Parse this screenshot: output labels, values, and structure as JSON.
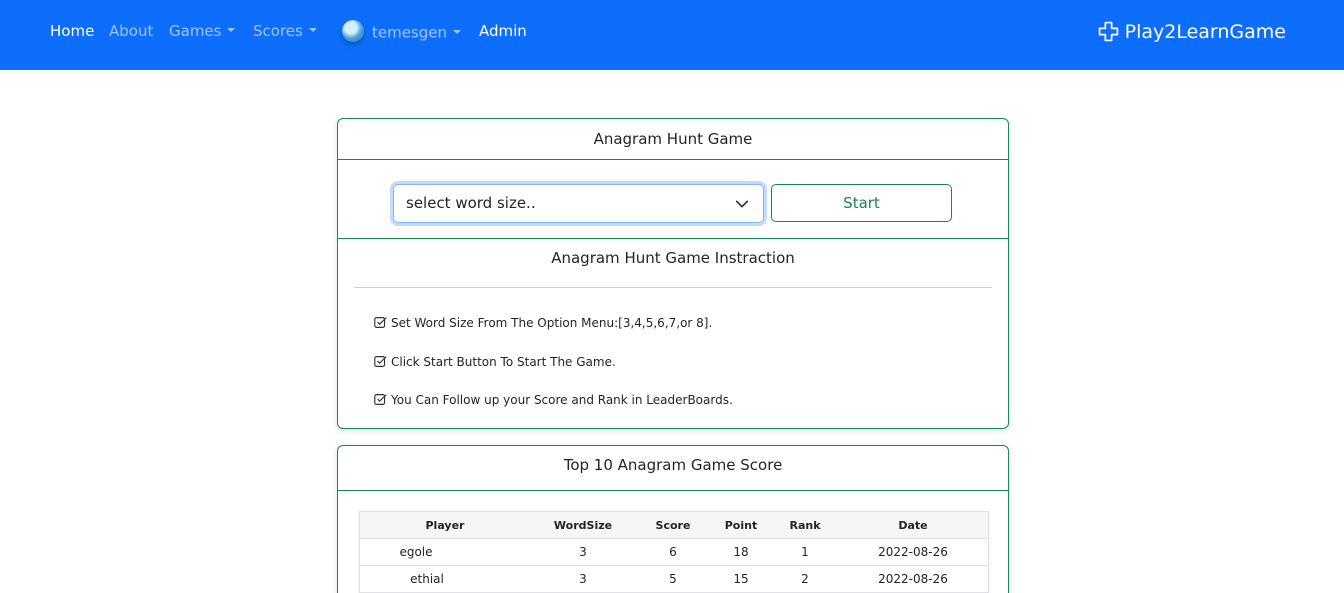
{
  "nav": {
    "items": [
      {
        "label": "Home",
        "active": true
      },
      {
        "label": "About",
        "active": false
      },
      {
        "label": "Games",
        "active": false,
        "dropdown": true
      },
      {
        "label": "Scores",
        "active": false,
        "dropdown": true
      },
      {
        "label": "temesgen",
        "active": false,
        "dropdown": true,
        "avatar_alt": "A"
      },
      {
        "label": "Admin",
        "active": true
      }
    ],
    "brand": "Play2LearnGame",
    "brand_icon": "plus-outline-icon"
  },
  "game_card": {
    "title": "Anagram Hunt Game",
    "select_placeholder": "select word size..",
    "start_label": "Start",
    "instructions_title": "Anagram Hunt Game Instraction",
    "instructions": [
      "Set Word Size From The Option Menu:[3,4,5,6,7,or 8].",
      "Click Start Button To Start The Game.",
      "You Can Follow up your Score and Rank in LeaderBoards."
    ]
  },
  "score_card": {
    "title": "Top 10 Anagram Game Score",
    "columns": [
      "Player",
      "WordSize",
      "Score",
      "Point",
      "Rank",
      "Date"
    ],
    "rows": [
      [
        "egole",
        "3",
        "6",
        "18",
        "1",
        "2022-08-26"
      ],
      [
        "ethial",
        "3",
        "5",
        "15",
        "2",
        "2022-08-26"
      ]
    ]
  },
  "colors": {
    "navbar": "#0d6efd",
    "accent_green": "#198754",
    "focus_blue": "#86b7fe"
  }
}
